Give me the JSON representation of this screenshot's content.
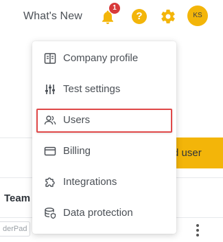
{
  "topbar": {
    "whats_new": "What's New",
    "notification_count": "1",
    "help_glyph": "?",
    "avatar_initials": "KS",
    "icons": [
      "bell-icon",
      "help-icon",
      "gear-icon"
    ]
  },
  "menu": {
    "items": [
      {
        "label": "Company profile",
        "icon": "company-profile-icon"
      },
      {
        "label": "Test settings",
        "icon": "sliders-icon"
      },
      {
        "label": "Users",
        "icon": "users-icon"
      },
      {
        "label": "Billing",
        "icon": "credit-card-icon"
      },
      {
        "label": "Integrations",
        "icon": "puzzle-icon"
      },
      {
        "label": "Data protection",
        "icon": "database-shield-icon"
      }
    ],
    "highlighted": "Users"
  },
  "background": {
    "add_user_label": "d user",
    "team_label": "Team",
    "row_chip_label": "derPad"
  },
  "colors": {
    "accent": "#f3b509",
    "badge": "#d83a3a",
    "highlight_border": "#e04848",
    "text": "#4a4f55"
  }
}
